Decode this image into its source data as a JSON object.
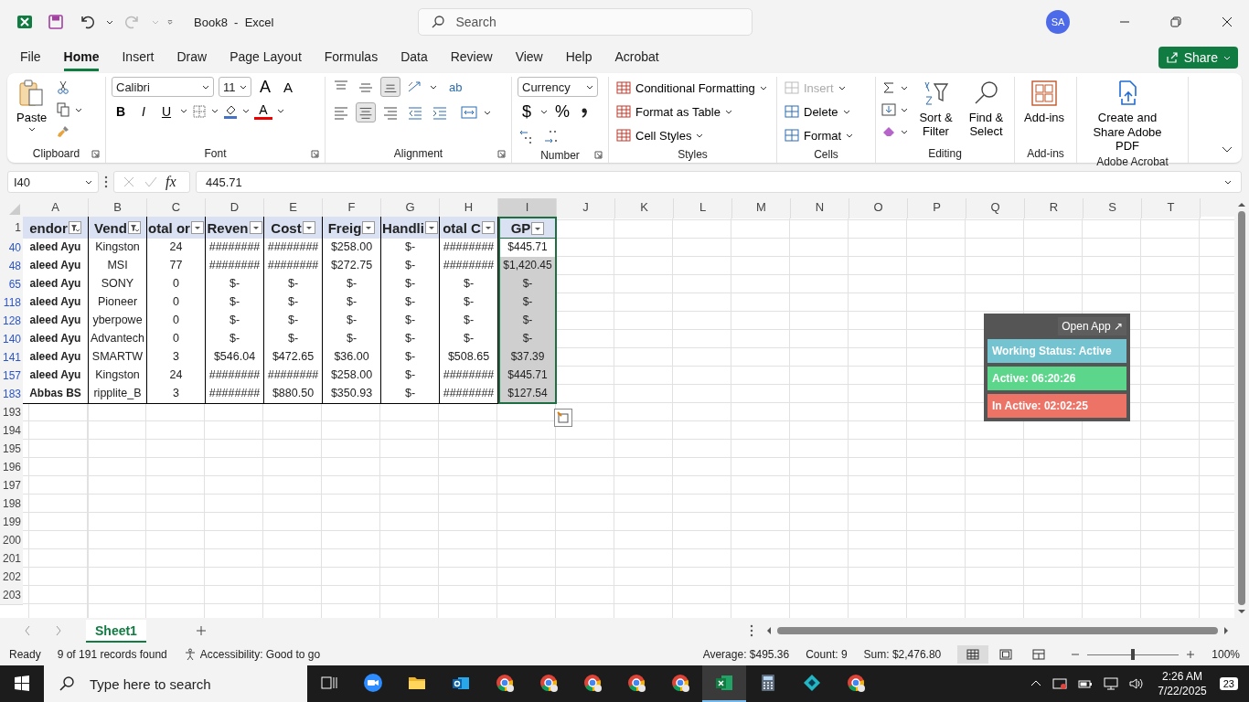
{
  "window": {
    "title": "Book8  -  Excel",
    "search_placeholder": "Search",
    "user_initials": "SA"
  },
  "ribbon_tabs": [
    {
      "label": "File",
      "selected": false
    },
    {
      "label": "Home",
      "selected": true
    },
    {
      "label": "Insert",
      "selected": false
    },
    {
      "label": "Draw",
      "selected": false
    },
    {
      "label": "Page Layout",
      "selected": false
    },
    {
      "label": "Formulas",
      "selected": false
    },
    {
      "label": "Data",
      "selected": false
    },
    {
      "label": "Review",
      "selected": false
    },
    {
      "label": "View",
      "selected": false
    },
    {
      "label": "Help",
      "selected": false
    },
    {
      "label": "Acrobat",
      "selected": false
    }
  ],
  "share_button": "Share",
  "ribbon": {
    "clipboard": {
      "label": "Clipboard",
      "paste": "Paste"
    },
    "font": {
      "label": "Font",
      "font_name": "Calibri",
      "font_size": "11",
      "grow": "A",
      "shrink": "A",
      "bold": "B",
      "italic": "I",
      "underline": "U",
      "font_color": "A"
    },
    "alignment": {
      "label": "Alignment",
      "wrap": "ab"
    },
    "number": {
      "label": "Number",
      "format": "Currency",
      "currency": "$",
      "percent": "%"
    },
    "styles": {
      "label": "Styles",
      "buttons": [
        "Conditional Formatting",
        "Format as Table",
        "Cell Styles"
      ]
    },
    "cells": {
      "label": "Cells",
      "buttons": [
        {
          "label": "Insert",
          "disabled": true
        },
        {
          "label": "Delete",
          "disabled": false
        },
        {
          "label": "Format",
          "disabled": false
        }
      ]
    },
    "editing": {
      "label": "Editing",
      "sort": "Sort & Filter",
      "find": "Find & Select"
    },
    "addins": {
      "label": "Add-ins",
      "button": "Add-ins"
    },
    "acrobat": {
      "label": "Adobe Acrobat",
      "button": "Create and Share Adobe PDF"
    }
  },
  "formula_bar": {
    "name_box": "I40",
    "fx": "fx",
    "value": "445.71"
  },
  "columns": [
    {
      "label": "A",
      "selected": false
    },
    {
      "label": "B",
      "selected": false
    },
    {
      "label": "C",
      "selected": false
    },
    {
      "label": "D",
      "selected": false
    },
    {
      "label": "E",
      "selected": false
    },
    {
      "label": "F",
      "selected": false
    },
    {
      "label": "G",
      "selected": false
    },
    {
      "label": "H",
      "selected": false
    },
    {
      "label": "I",
      "selected": true
    },
    {
      "label": "J",
      "selected": false
    },
    {
      "label": "K",
      "selected": false
    },
    {
      "label": "L",
      "selected": false
    },
    {
      "label": "M",
      "selected": false
    },
    {
      "label": "N",
      "selected": false
    },
    {
      "label": "O",
      "selected": false
    },
    {
      "label": "P",
      "selected": false
    },
    {
      "label": "Q",
      "selected": false
    },
    {
      "label": "R",
      "selected": false
    },
    {
      "label": "S",
      "selected": false
    },
    {
      "label": "T",
      "selected": false
    }
  ],
  "table": {
    "header_row": "1",
    "headers": [
      {
        "text": "endor",
        "filtered": true
      },
      {
        "text": "Vend",
        "filtered": true
      },
      {
        "text": "otal or",
        "filtered": false
      },
      {
        "text": "Reven",
        "filtered": false
      },
      {
        "text": "Cost",
        "filtered": false
      },
      {
        "text": "Freig",
        "filtered": false
      },
      {
        "text": "Handli",
        "filtered": false
      },
      {
        "text": "otal C",
        "filtered": false
      },
      {
        "text": "GP",
        "filtered": false
      }
    ],
    "rows": [
      {
        "number": "40",
        "selected": true,
        "active": true,
        "cells": [
          "aleed Ayu",
          "Kingston",
          "24",
          "########",
          "########",
          "$258.00",
          "$-",
          "########",
          "$445.71"
        ]
      },
      {
        "number": "48",
        "selected": true,
        "active": false,
        "cells": [
          "aleed Ayu",
          "MSI",
          "77",
          "########",
          "########",
          "$272.75",
          "$-",
          "########",
          "$1,420.45"
        ]
      },
      {
        "number": "65",
        "selected": true,
        "active": false,
        "cells": [
          "aleed Ayu",
          "SONY",
          "0",
          "$-",
          "$-",
          "$-",
          "$-",
          "$-",
          "$-"
        ]
      },
      {
        "number": "118",
        "selected": true,
        "active": false,
        "cells": [
          "aleed Ayu",
          "Pioneer",
          "0",
          "$-",
          "$-",
          "$-",
          "$-",
          "$-",
          "$-"
        ]
      },
      {
        "number": "128",
        "selected": true,
        "active": false,
        "cells": [
          "aleed Ayu",
          "yberpowe",
          "0",
          "$-",
          "$-",
          "$-",
          "$-",
          "$-",
          "$-"
        ]
      },
      {
        "number": "140",
        "selected": true,
        "active": false,
        "cells": [
          "aleed Ayu",
          "Advantech",
          "0",
          "$-",
          "$-",
          "$-",
          "$-",
          "$-",
          "$-"
        ]
      },
      {
        "number": "141",
        "selected": true,
        "active": false,
        "cells": [
          "aleed Ayu",
          "SMARTW",
          "3",
          "$546.04",
          "$472.65",
          "$36.00",
          "$-",
          "$508.65",
          "$37.39"
        ]
      },
      {
        "number": "157",
        "selected": true,
        "active": false,
        "cells": [
          "aleed Ayu",
          "Kingston",
          "24",
          "########",
          "########",
          "$258.00",
          "$-",
          "########",
          "$445.71"
        ]
      },
      {
        "number": "183",
        "selected": true,
        "active": false,
        "cells": [
          "Abbas BS",
          "ripplite_B",
          "3",
          "########",
          "$880.50",
          "$350.93",
          "$-",
          "########",
          "$127.54"
        ]
      }
    ]
  },
  "empty_rows": [
    "193",
    "194",
    "195",
    "196",
    "197",
    "198",
    "199",
    "200",
    "201",
    "202",
    "203"
  ],
  "status_widget": {
    "button": "Open App ↗",
    "items": [
      {
        "text": "Working Status: Active",
        "color": "#74c3d0"
      },
      {
        "text": "Active: 06:20:26",
        "color": "#5cd68b"
      },
      {
        "text": "In Active: 02:02:25",
        "color": "#ec7366"
      }
    ]
  },
  "sheet_tabs": [
    {
      "label": "Sheet1",
      "selected": true
    }
  ],
  "status_bar": {
    "mode": "Ready",
    "filter": "9 of 191 records found",
    "accessibility": "Accessibility: Good to go",
    "average": "Average: $495.36",
    "count": "Count: 9",
    "sum": "Sum: $2,476.80",
    "views": [
      {
        "kind": "normal",
        "selected": true
      },
      {
        "kind": "page-layout",
        "selected": false
      },
      {
        "kind": "page-break",
        "selected": false
      }
    ],
    "zoom": {
      "level": 0.5,
      "reading": "100%"
    }
  },
  "taskbar": {
    "search_placeholder": "Type here to search",
    "apps": [
      {
        "kind": "task-view",
        "active": false
      },
      {
        "kind": "video",
        "active": false
      },
      {
        "kind": "folder",
        "active": false
      },
      {
        "kind": "mail",
        "active": false
      },
      {
        "kind": "browser",
        "active": false
      },
      {
        "kind": "browser",
        "active": false
      },
      {
        "kind": "browser",
        "active": false
      },
      {
        "kind": "browser",
        "active": false
      },
      {
        "kind": "browser",
        "active": false
      },
      {
        "kind": "spreadsheet",
        "active": true
      },
      {
        "kind": "calculator",
        "active": false
      },
      {
        "kind": "diamond",
        "active": false
      },
      {
        "kind": "browser",
        "active": false
      }
    ],
    "time": "2:26 AM",
    "date": "7/22/2025",
    "notifications": "23"
  }
}
